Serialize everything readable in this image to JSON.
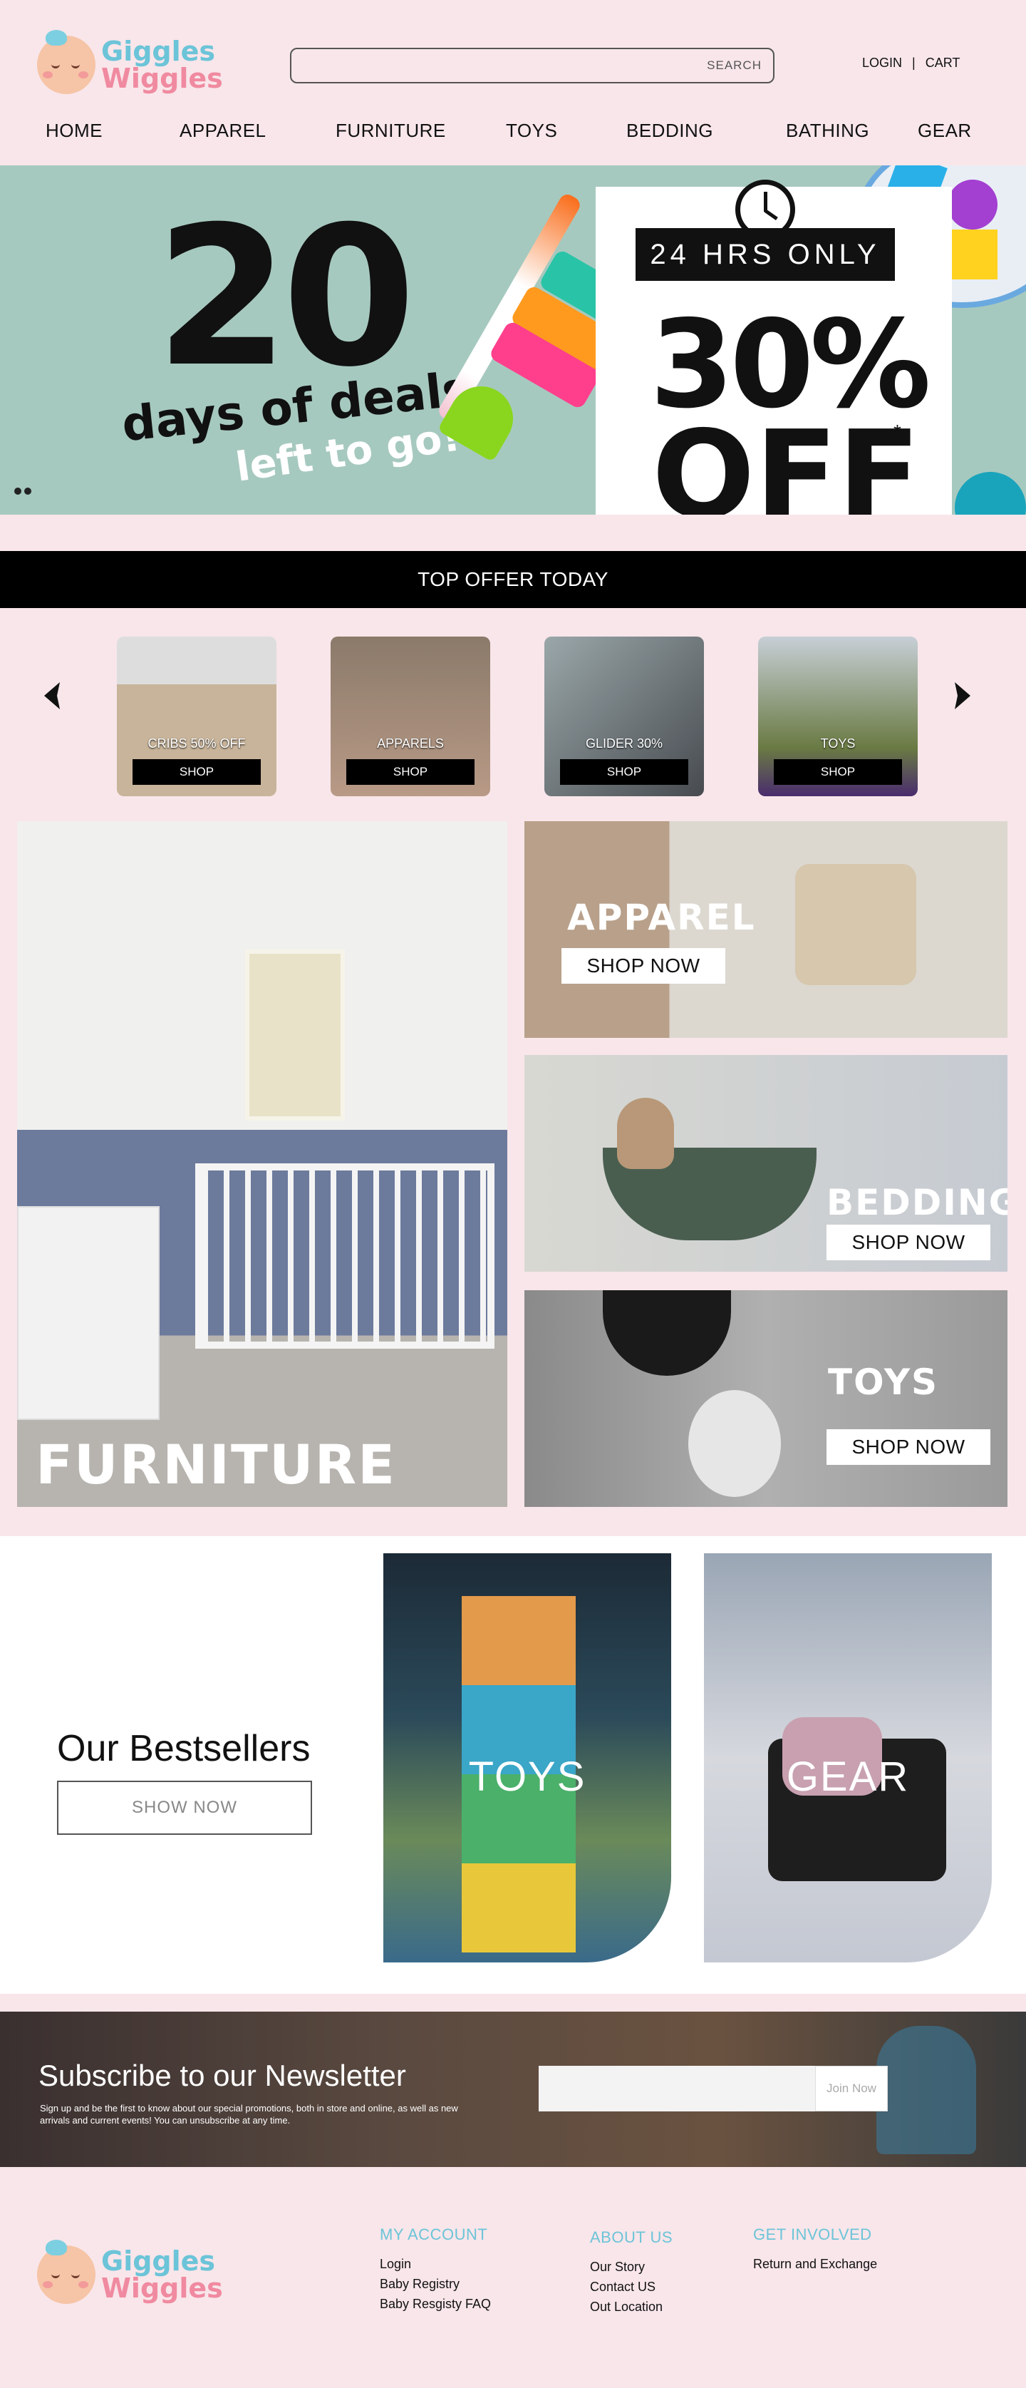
{
  "brand": {
    "line1": "Giggles",
    "line2": "Wiggles"
  },
  "search": {
    "placeholder": "",
    "button": "SEARCH"
  },
  "top_links": {
    "login": "LOGIN",
    "separator": "|",
    "cart": "CART"
  },
  "nav": [
    "HOME",
    "APPAREL",
    "FURNITURE",
    "TOYS",
    "BEDDING",
    "BATHING",
    "GEAR"
  ],
  "hero": {
    "count": "20",
    "days_text": "days of deals",
    "left_text": "left to go!",
    "badge": "24 HRS ONLY",
    "percent": "30%",
    "off": "OFF",
    "asterisk": "*"
  },
  "offer_bar": "TOP OFFER TODAY",
  "carousel": [
    {
      "label": "CRIBS 50% OFF",
      "button": "SHOP"
    },
    {
      "label": "APPARELS",
      "button": "SHOP"
    },
    {
      "label": "GLIDER 30%",
      "button": "SHOP"
    },
    {
      "label": "TOYS",
      "button": "SHOP"
    }
  ],
  "categories": {
    "furniture": "FURNITURE",
    "apparel": {
      "title": "APPAREL",
      "button": "SHOP NOW"
    },
    "bedding": {
      "title": "BEDDING",
      "button": "SHOP NOW"
    },
    "toys": {
      "title": "TOYS",
      "button": "SHOP NOW"
    }
  },
  "bestsellers": {
    "title": "Our Bestsellers",
    "button": "SHOW NOW",
    "tiles": [
      "TOYS",
      "GEAR"
    ]
  },
  "newsletter": {
    "title": "Subscribe to our Newsletter",
    "text": "Sign up and be the first to know about our special promotions, both in store and online, as well as new arrivals and current events! You can unsubscribe at any time.",
    "button": "Join Now"
  },
  "footer": {
    "my_account": {
      "title": "MY ACCOUNT",
      "links": [
        "Login",
        "Baby Registry",
        "Baby Resgisty FAQ"
      ]
    },
    "about_us": {
      "title": "ABOUT US",
      "links": [
        "Our Story",
        "Contact US",
        "Out Location"
      ]
    },
    "get_involved": {
      "title": "GET INVOLVED",
      "links": [
        "Return and Exchange"
      ]
    }
  },
  "colors": {
    "background": "#f8e6ea",
    "hero_bg": "#a6c9bf",
    "accent_blue": "#6cc4d8",
    "accent_pink": "#f08aa0"
  }
}
